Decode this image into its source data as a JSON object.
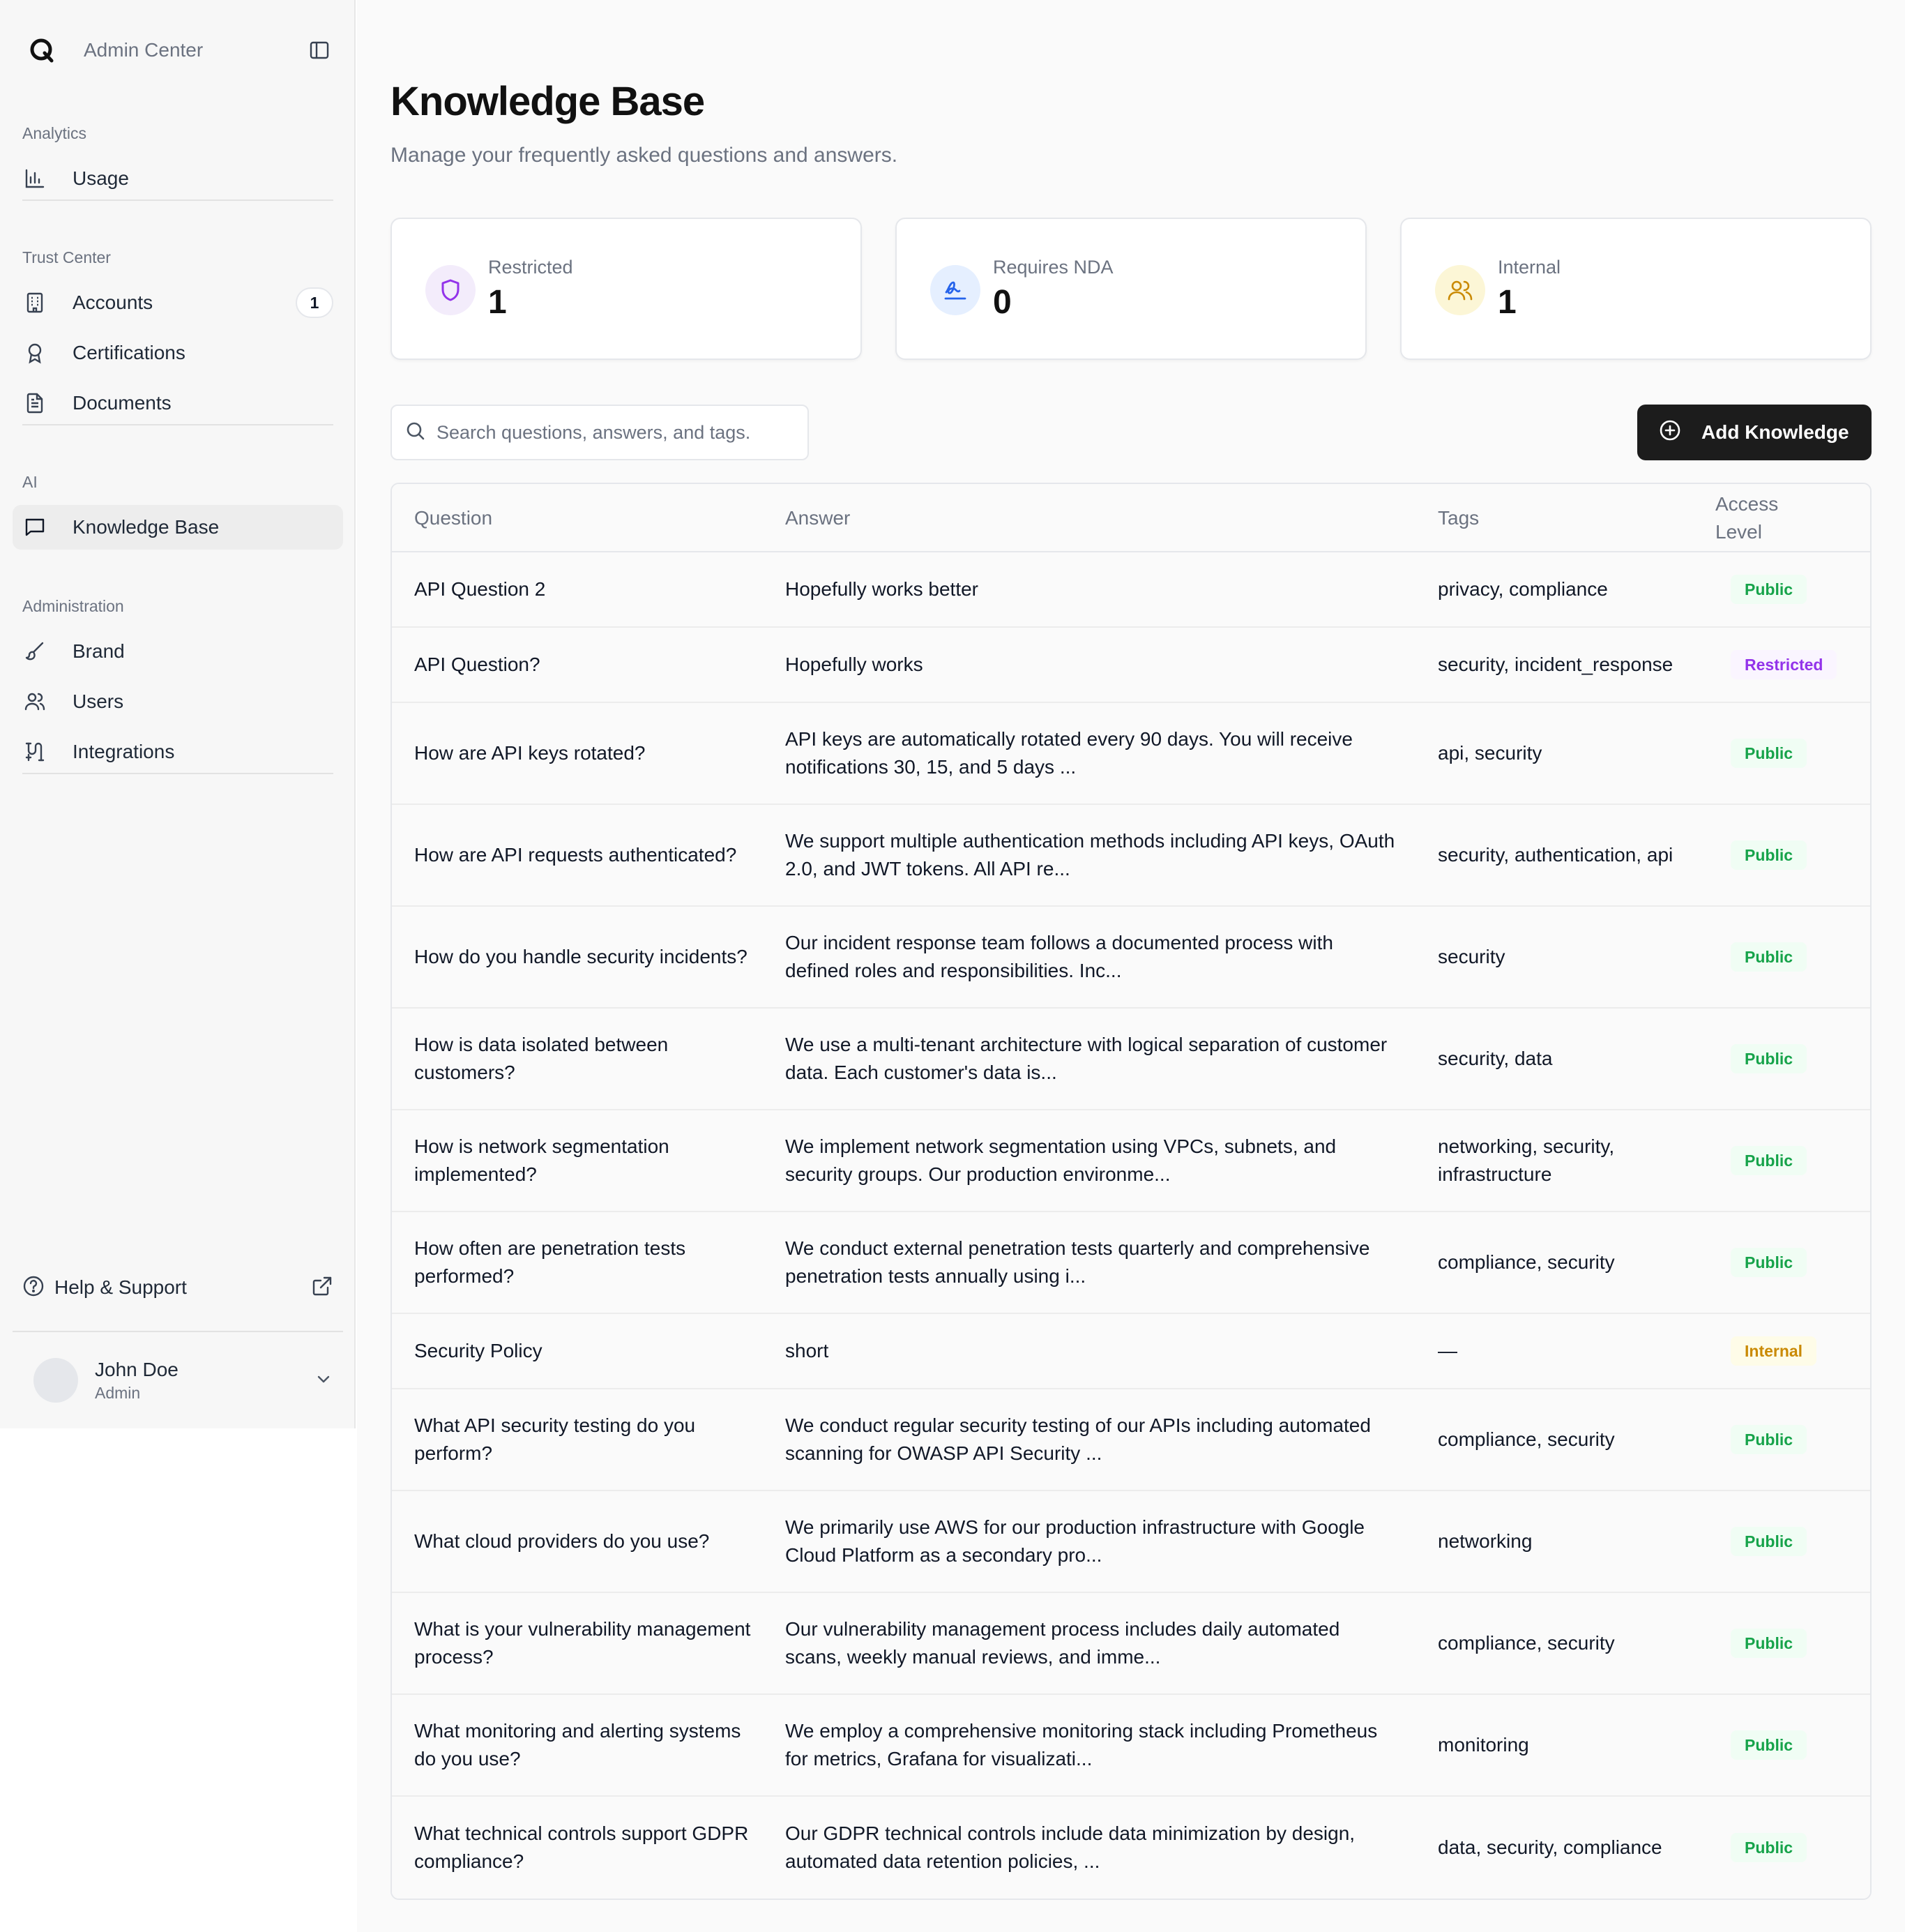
{
  "sidebar": {
    "app_name": "Admin Center",
    "sections": {
      "analytics": "Analytics",
      "trust_center": "Trust Center",
      "ai": "AI",
      "administration": "Administration"
    },
    "items": {
      "usage": "Usage",
      "accounts": "Accounts",
      "accounts_badge": "1",
      "certifications": "Certifications",
      "documents": "Documents",
      "knowledge_base": "Knowledge Base",
      "brand": "Brand",
      "users": "Users",
      "integrations": "Integrations"
    },
    "help": "Help & Support",
    "user": {
      "name": "John Doe",
      "role": "Admin"
    }
  },
  "page": {
    "title": "Knowledge Base",
    "subtitle": "Manage your frequently asked questions and answers."
  },
  "stats": [
    {
      "label": "Restricted",
      "value": "1",
      "icon": "shield-icon",
      "color": "#9333ea"
    },
    {
      "label": "Requires NDA",
      "value": "0",
      "icon": "signature-icon",
      "color": "#2563eb"
    },
    {
      "label": "Internal",
      "value": "1",
      "icon": "users-icon",
      "color": "#ca8a04"
    }
  ],
  "search": {
    "placeholder": "Search questions, answers, and tags."
  },
  "add_button": "Add Knowledge",
  "table": {
    "headers": {
      "question": "Question",
      "answer": "Answer",
      "tags": "Tags",
      "access_level_1": "Access",
      "access_level_2": "Level"
    },
    "rows": [
      {
        "question": "API Question 2",
        "answer": "Hopefully works better",
        "tags": "privacy, compliance",
        "access": "Public"
      },
      {
        "question": "API Question?",
        "answer": "Hopefully works",
        "tags": "security, incident_response",
        "access": "Restricted"
      },
      {
        "question": "How are API keys rotated?",
        "answer": "API keys are automatically rotated every 90 days. You will receive notifications 30, 15, and 5 days ...",
        "tags": "api, security",
        "access": "Public"
      },
      {
        "question": "How are API requests authenticated?",
        "answer": "We support multiple authentication methods including API keys, OAuth 2.0, and JWT tokens. All API re...",
        "tags": "security, authentication, api",
        "access": "Public"
      },
      {
        "question": "How do you handle security incidents?",
        "answer": "Our incident response team follows a documented process with defined roles and responsibilities. Inc...",
        "tags": "security",
        "access": "Public"
      },
      {
        "question": "How is data isolated between customers?",
        "answer": "We use a multi-tenant architecture with logical separation of customer data. Each customer's data is...",
        "tags": "security, data",
        "access": "Public"
      },
      {
        "question": "How is network segmentation implemented?",
        "answer": "We implement network segmentation using VPCs, subnets, and security groups. Our production environme...",
        "tags": "networking, security, infrastructure",
        "access": "Public"
      },
      {
        "question": "How often are penetration tests performed?",
        "answer": "We conduct external penetration tests quarterly and comprehensive penetration tests annually using i...",
        "tags": "compliance, security",
        "access": "Public"
      },
      {
        "question": "Security Policy",
        "answer": "short",
        "tags": "—",
        "access": "Internal"
      },
      {
        "question": "What API security testing do you perform?",
        "answer": "We conduct regular security testing of our APIs including automated scanning for OWASP API Security ...",
        "tags": "compliance, security",
        "access": "Public"
      },
      {
        "question": "What cloud providers do you use?",
        "answer": "We primarily use AWS for our production infrastructure with Google Cloud Platform as a secondary pro...",
        "tags": "networking",
        "access": "Public"
      },
      {
        "question": "What is your vulnerability management process?",
        "answer": "Our vulnerability management process includes daily automated scans, weekly manual reviews, and imme...",
        "tags": "compliance, security",
        "access": "Public"
      },
      {
        "question": "What monitoring and alerting systems do you use?",
        "answer": "We employ a comprehensive monitoring stack including Prometheus for metrics, Grafana for visualizati...",
        "tags": "monitoring",
        "access": "Public"
      },
      {
        "question": "What technical controls support GDPR compliance?",
        "answer": "Our GDPR technical controls include data minimization by design, automated data retention policies, ...",
        "tags": "data, security, compliance",
        "access": "Public"
      }
    ]
  }
}
